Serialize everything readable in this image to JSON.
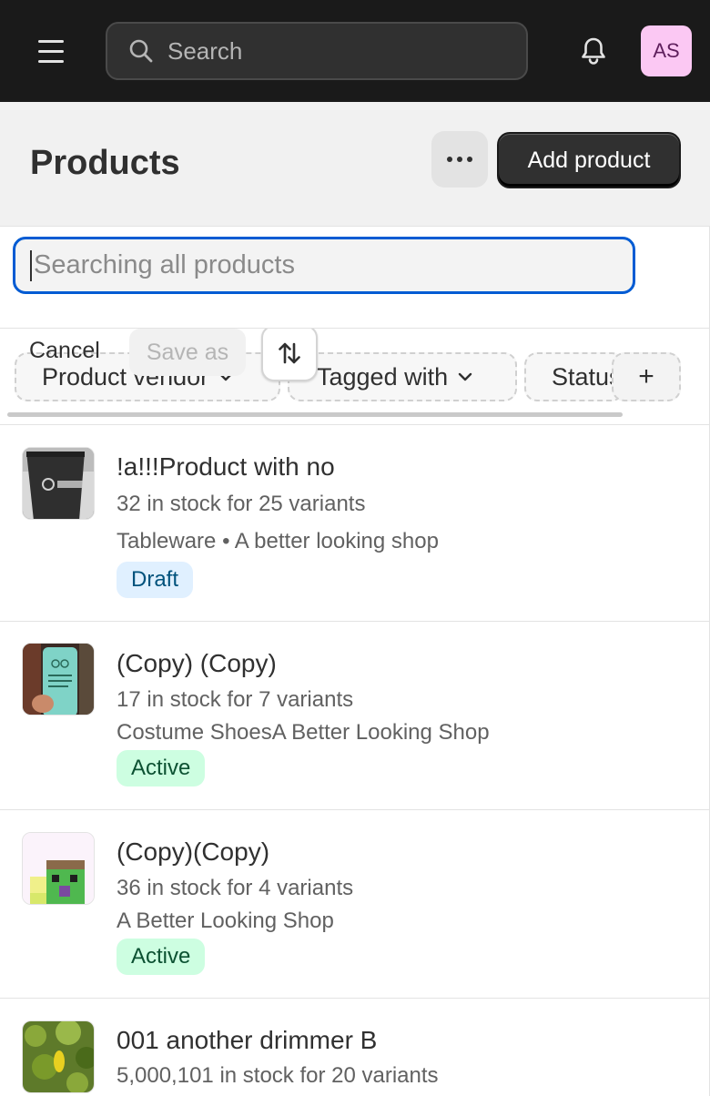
{
  "topbar": {
    "search_placeholder": "Search",
    "avatar_initials": "AS"
  },
  "header": {
    "title": "Products",
    "add_button": "Add product"
  },
  "search_panel": {
    "placeholder": "Searching all products"
  },
  "filter_bar": {
    "cancel": "Cancel",
    "save_as": "Save as",
    "chips": [
      "Product vendor",
      "Tagged with",
      "Status"
    ],
    "add_chip": "+"
  },
  "products": [
    {
      "title": "!a!!!Product with no",
      "stock": "32 in stock for 25 variants",
      "meta": "Tableware • A better looking shop",
      "status": "Draft"
    },
    {
      "title": "(Copy) (Copy)",
      "stock": "17 in stock for 7 variants",
      "meta": "Costume ShoesA Better Looking Shop",
      "status": "Active"
    },
    {
      "title": "(Copy)(Copy)",
      "stock": "36 in stock for 4 variants",
      "meta": "A Better Looking Shop",
      "status": "Active"
    },
    {
      "title": "001 another drimmer B",
      "stock": "5,000,101 in stock for 20 variants"
    }
  ],
  "icons": {
    "menu": "hamburger-icon",
    "search": "search-icon",
    "notifications": "bell-icon",
    "more": "ellipsis-icon",
    "sort": "sort-arrows-icon",
    "chevron": "chevron-down-icon"
  },
  "colors": {
    "topbar_bg": "#1a1a1a",
    "focus_ring": "#005bd3",
    "draft_badge_bg": "#e0f0ff",
    "active_badge_bg": "#cdfee1",
    "avatar_bg": "#fbc8f3"
  }
}
